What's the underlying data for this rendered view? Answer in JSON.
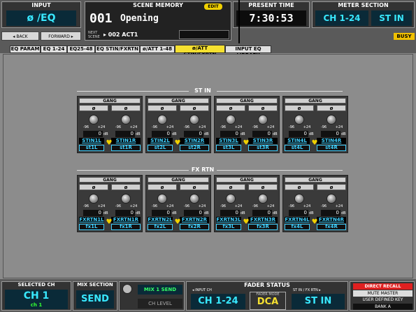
{
  "header": {
    "input_label": "INPUT",
    "input_value": "ø /EQ",
    "back_label": "◂ BACK",
    "forward_label": "FORWARD ▸",
    "scene_memory_label": "SCENE MEMORY",
    "edit_badge": "EDIT",
    "scene_number": "001",
    "scene_name": "Opening",
    "next_label_1": "NEXT",
    "next_label_2": "SCENE",
    "next_scene": "▸ 002 ACT1",
    "present_time_label": "PRESENT TIME",
    "present_time": "7:30:53",
    "meter_section_label": "METER SECTION",
    "meter_ch": "CH 1-24",
    "meter_st": "ST IN",
    "busy": "BUSY"
  },
  "tabs": [
    {
      "label": "EQ PARAM"
    },
    {
      "label": "EQ 1-24"
    },
    {
      "label": "EQ25-48"
    },
    {
      "label": "EQ STIN/FXRTN"
    },
    {
      "label": "ø/ATT 1-48"
    },
    {
      "label": "ø/ATT STIN/FXRTN"
    },
    {
      "label": "INPUT EQ LIBRARY"
    }
  ],
  "sections": {
    "st_in": "ST IN",
    "fx_rtn": "FX RTN"
  },
  "channel_common": {
    "gang": "GANG",
    "phase": "ø",
    "range_min": "-96",
    "range_max": "+24",
    "value": "0",
    "unit": "dB"
  },
  "st_in": [
    {
      "l_name": "STIN1L",
      "l_short": "st1L",
      "r_name": "STIN1R",
      "r_short": "st1R"
    },
    {
      "l_name": "STIN2L",
      "l_short": "st2L",
      "r_name": "STIN2R",
      "r_short": "st2R"
    },
    {
      "l_name": "STIN3L",
      "l_short": "st3L",
      "r_name": "STIN3R",
      "r_short": "st3R"
    },
    {
      "l_name": "STIN4L",
      "l_short": "st4L",
      "r_name": "STIN4R",
      "r_short": "st4R"
    }
  ],
  "fx_rtn": [
    {
      "l_name": "FXRTN1L",
      "l_short": "fx1L",
      "r_name": "FXRTN1R",
      "r_short": "fx1R"
    },
    {
      "l_name": "FXRTN2L",
      "l_short": "fx2L",
      "r_name": "FXRTN2R",
      "r_short": "fx2R"
    },
    {
      "l_name": "FXRTN3L",
      "l_short": "fx3L",
      "r_name": "FXRTN3R",
      "r_short": "fx3R"
    },
    {
      "l_name": "FXRTN4L",
      "l_short": "fx4L",
      "r_name": "FXRTN4R",
      "r_short": "fx4R"
    }
  ],
  "footer": {
    "selected_ch_label": "SELECTED CH",
    "selected_ch": "CH 1",
    "selected_ch_sub": "ch 1",
    "mix_section_label": "MIX SECTION",
    "mix_section": "SEND",
    "mix_send": "MIX 1 SEND",
    "ch_level": "CH LEVEL",
    "fader_status_label": "FADER STATUS",
    "input_ch_label": "◂ INPUT CH",
    "input_ch": "CH 1-24",
    "fader_mode_label": "FADER MODE",
    "fader_mode": "DCA",
    "stin_fx_label": "ST IN / FX RTN ▸",
    "stin_fx": "ST IN",
    "direct_recall": "DIRECT RECALL",
    "mute_master": "MUTE MASTER",
    "user_defined_key": "USER DEFINED KEY",
    "bank": "BANK A"
  },
  "colors": {
    "accent_cyan": "#38e8ff",
    "active_tab": "#f5e030",
    "direct_recall": "#e02020"
  }
}
